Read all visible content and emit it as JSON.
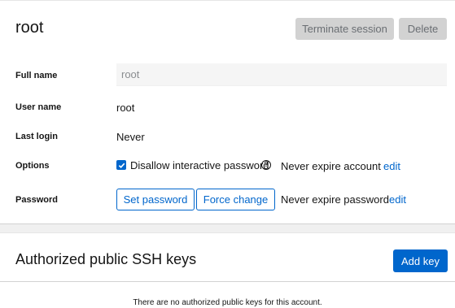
{
  "account": {
    "title": "root",
    "terminate_label": "Terminate session",
    "delete_label": "Delete"
  },
  "details": {
    "full_name_label": "Full name",
    "full_name_value": "root",
    "user_name_label": "User name",
    "user_name_value": "root",
    "last_login_label": "Last login",
    "last_login_value": "Never",
    "options_label": "Options",
    "disallow_password_label": "Disallow interactive password",
    "disallow_password_checked": true,
    "help_icon": "?",
    "account_expiry_text": "Never expire account",
    "account_expiry_edit": "edit",
    "password_label": "Password",
    "set_password_label": "Set password",
    "force_change_label": "Force change",
    "password_expiry_text": "Never expire password",
    "password_expiry_edit": "edit"
  },
  "ssh_keys": {
    "title": "Authorized public SSH keys",
    "add_key_label": "Add key",
    "empty_message": "There are no authorized public keys for this account."
  },
  "colors": {
    "accent": "#0066cc",
    "disabled_bg": "#d2d2d2",
    "disabled_text": "#6a6e73"
  }
}
